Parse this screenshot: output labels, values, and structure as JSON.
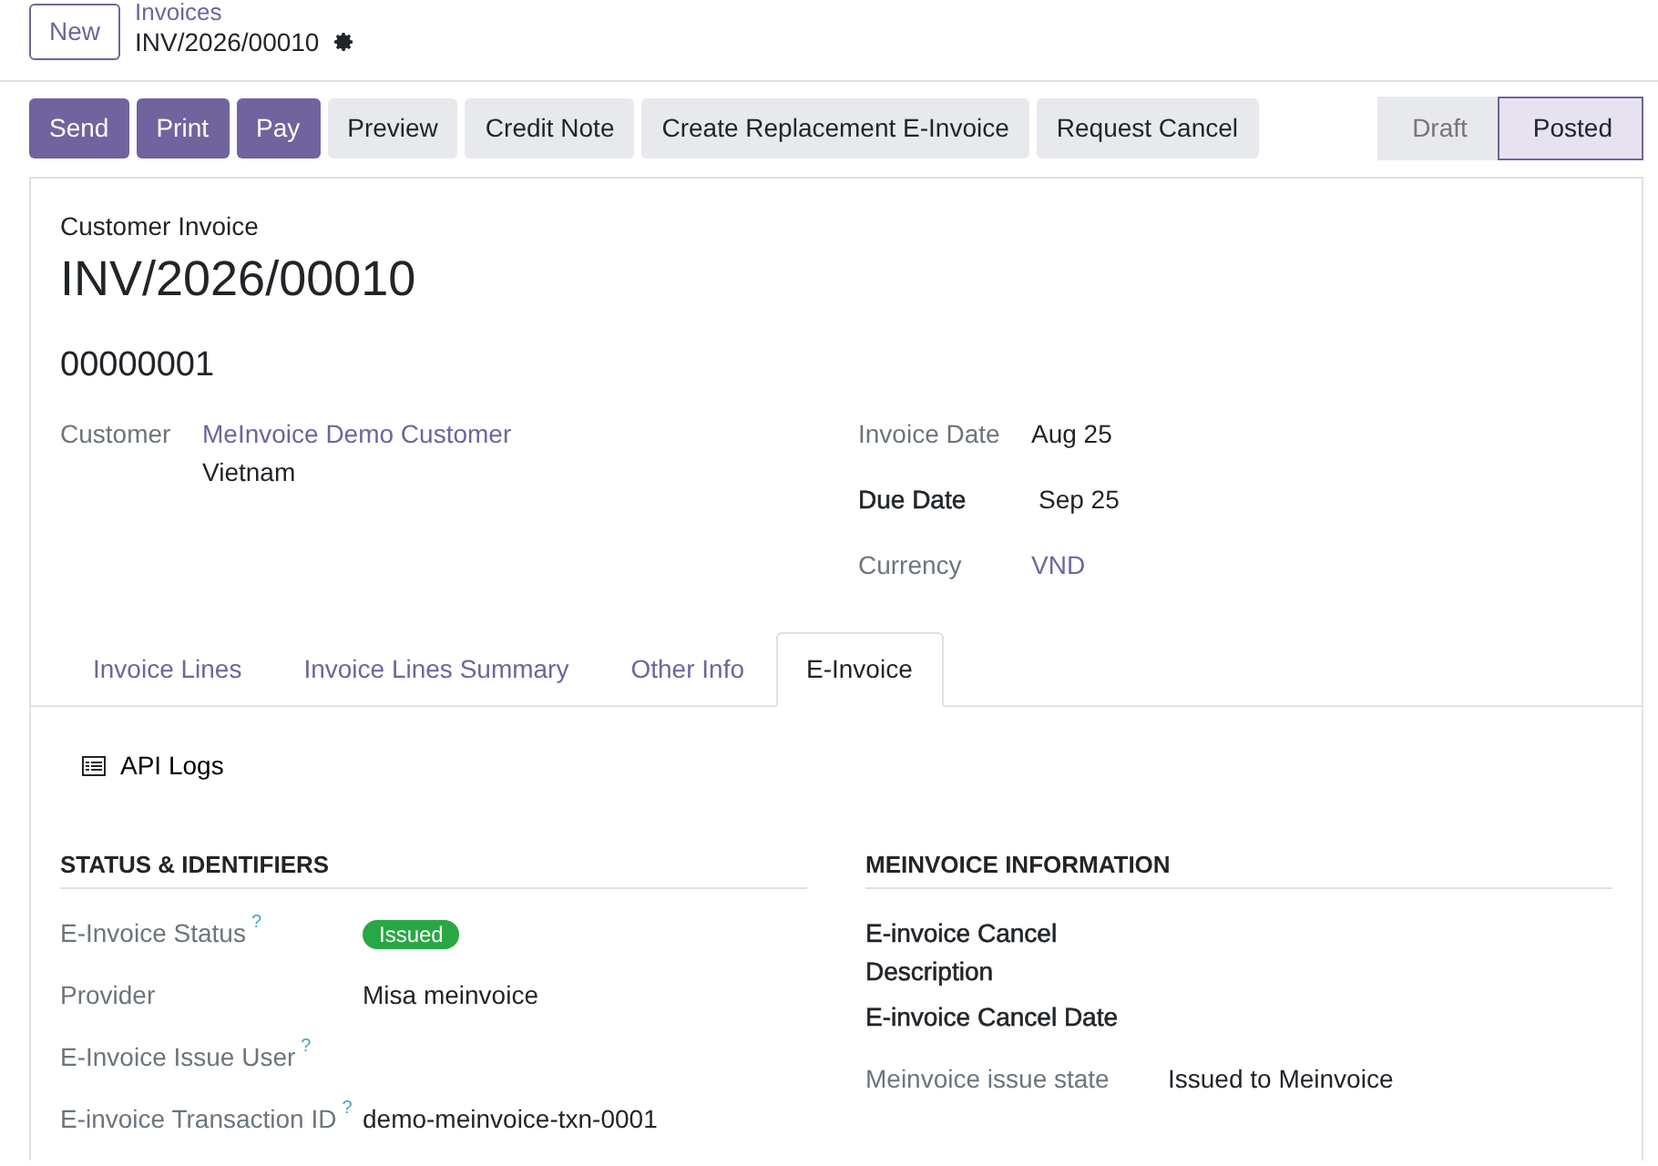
{
  "control_panel": {
    "new_button": "New",
    "breadcrumb": {
      "parent": "Invoices",
      "current": "INV/2026/00010"
    }
  },
  "action_buttons": [
    {
      "label": "Send",
      "kind": "primary"
    },
    {
      "label": "Print",
      "kind": "primary"
    },
    {
      "label": "Pay",
      "kind": "primary"
    },
    {
      "label": "Preview",
      "kind": "secondary"
    },
    {
      "label": "Credit Note",
      "kind": "secondary"
    },
    {
      "label": "Create Replacement E-Invoice",
      "kind": "secondary"
    },
    {
      "label": "Request Cancel",
      "kind": "secondary"
    }
  ],
  "status_steps": [
    {
      "label": "Draft",
      "selected": false
    },
    {
      "label": "Posted",
      "selected": true
    }
  ],
  "form": {
    "subtitle": "Customer Invoice",
    "title": "INV/2026/00010",
    "reference": "00000001",
    "left_fields": [
      {
        "label": "Customer",
        "value": "MeInvoice Demo Customer",
        "kind": "link",
        "extra": "Vietnam",
        "bold": false
      }
    ],
    "right_fields": [
      {
        "label": "Invoice Date",
        "value": "Aug 25",
        "kind": "text",
        "bold": false
      },
      {
        "label": "Due Date",
        "value": "Sep 25",
        "kind": "text",
        "bold": true
      },
      {
        "label": "Currency",
        "value": "VND",
        "kind": "link",
        "bold": false
      }
    ]
  },
  "tabs": [
    {
      "label": "Invoice Lines",
      "selected": false
    },
    {
      "label": "Invoice Lines Summary",
      "selected": false
    },
    {
      "label": "Other Info",
      "selected": false
    },
    {
      "label": "E-Invoice",
      "selected": true
    }
  ],
  "api_logs_button": "API Logs",
  "sections": [
    {
      "title": "STATUS & IDENTIFIERS",
      "fields": [
        {
          "label": "E-Invoice Status",
          "help": "?",
          "value": "Issued",
          "kind": "badge",
          "bold": false
        },
        {
          "label": "Provider",
          "value": "Misa meinvoice",
          "kind": "text",
          "bold": false
        },
        {
          "label": "E-Invoice Issue User",
          "help": "?",
          "bold": false
        },
        {
          "label": "E-invoice Transaction ID",
          "help": "?",
          "value": "demo-meinvoice-txn-0001",
          "kind": "text",
          "bold": false
        }
      ]
    },
    {
      "title": "MEINVOICE INFORMATION",
      "fields": [
        {
          "label": "E-invoice Cancel Description",
          "bold": true
        },
        {
          "label": "E-invoice Cancel Date",
          "bold": true
        },
        {
          "label": "Meinvoice issue state",
          "value": "Issued to Meinvoice",
          "kind": "text",
          "bold": false
        }
      ]
    }
  ]
}
